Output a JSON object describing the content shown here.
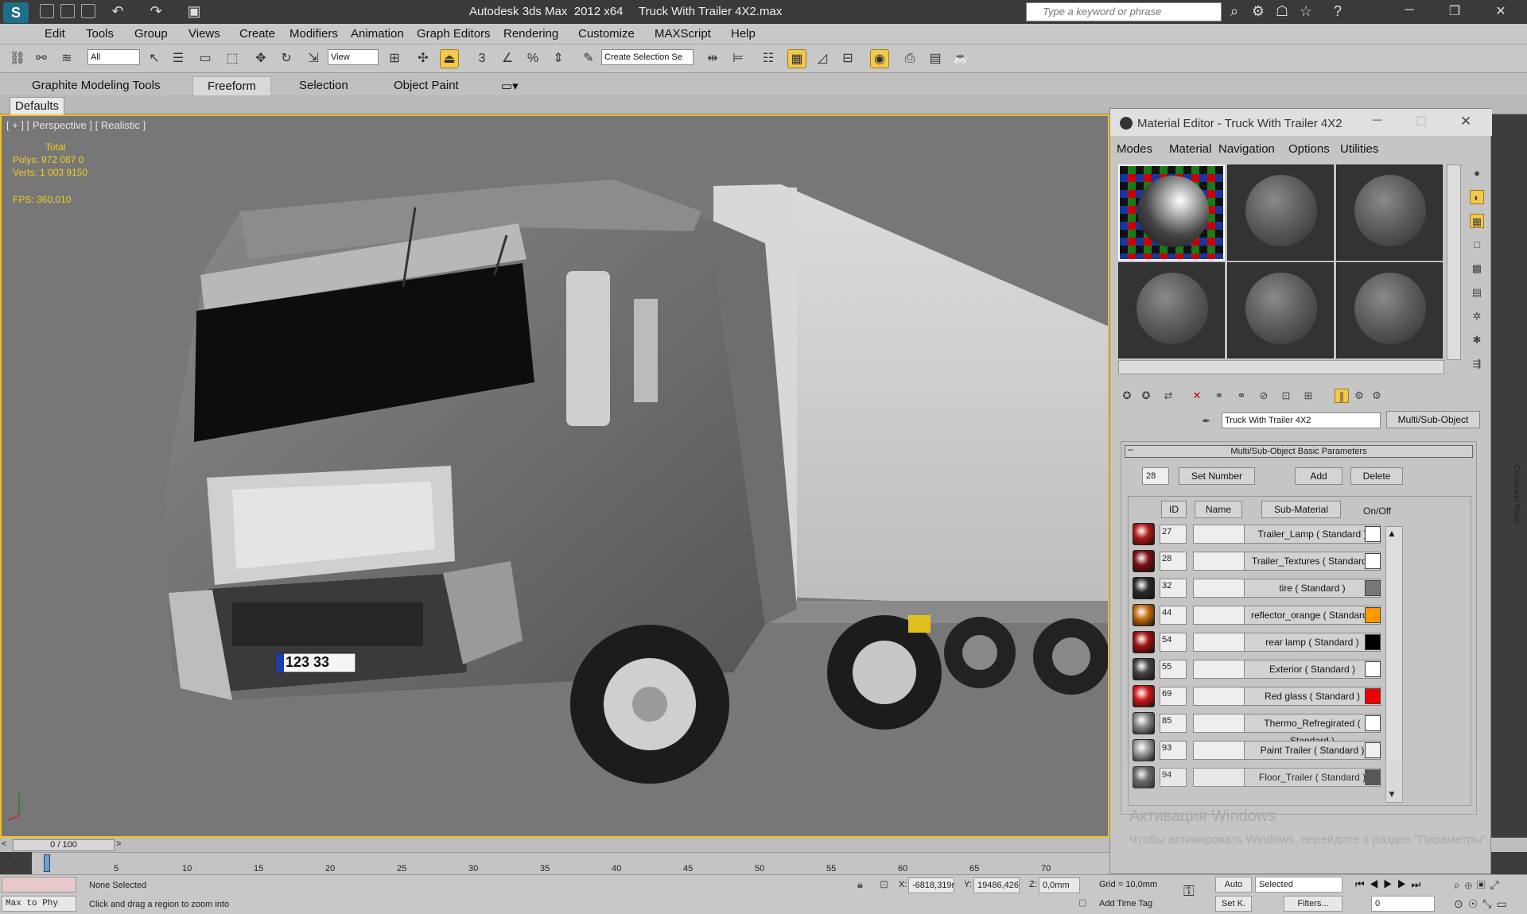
{
  "titlebar": {
    "logo": "S",
    "app_title": "Autodesk 3ds Max  2012 x64",
    "file_title": "Truck With Trailer 4X2.max",
    "search_placeholder": "Type a keyword or phrase"
  },
  "menu": [
    "Edit",
    "Tools",
    "Group",
    "Views",
    "Create",
    "Modifiers",
    "Animation",
    "Graph Editors",
    "Rendering",
    "Customize",
    "MAXScript",
    "Help"
  ],
  "toolbar": {
    "selection_filter": "All",
    "ref_coord": "View",
    "named_selection": "Create Selection Se"
  },
  "ribbon": {
    "tabs": [
      "Graphite Modeling Tools",
      "Freeform",
      "Selection",
      "Object Paint"
    ],
    "active": "Freeform",
    "defaults": "Defaults"
  },
  "viewport": {
    "label": "[ + ] [ Perspective ] [ Realistic ]",
    "stats_total": "Total",
    "polys": "Polys:  972 087   0",
    "verts": "Verts:  1 003 9150",
    "fps": "FPS:    360,010",
    "plate": "123 33"
  },
  "timeline": {
    "frame": "0 / 100",
    "ticks": [
      "0",
      "5",
      "10",
      "15",
      "20",
      "25",
      "30",
      "35",
      "40",
      "45",
      "50",
      "55",
      "60",
      "65",
      "70"
    ]
  },
  "status": {
    "maxscript": "Max to Phy",
    "selection": "None Selected",
    "prompt": "Click and drag a region to zoom into",
    "x_label": "X:",
    "x_value": "-6818,319r",
    "y_label": "Y:",
    "y_value": "19486,426",
    "z_label": "Z:",
    "z_value": "0,0mm",
    "grid": "Grid = 10,0mm",
    "add_time_tag": "Add Time Tag",
    "auto": "Auto",
    "set_key": "Set K.",
    "selected": "Selected",
    "filters": "Filters...",
    "frame_field": "0"
  },
  "material_editor": {
    "title": "Material Editor - Truck With Trailer 4X2",
    "menu": [
      "Modes",
      "Material",
      "Navigation",
      "Options",
      "Utilities"
    ],
    "material_name": "Truck With Trailer 4X2",
    "material_type": "Multi/Sub-Object",
    "rollout_title": "Multi/Sub-Object Basic Parameters",
    "collapse": "–",
    "count": "28",
    "set_number": "Set Number",
    "add": "Add",
    "delete": "Delete",
    "col_id": "ID",
    "col_name": "Name",
    "col_sub": "Sub-Material",
    "col_onoff": "On/Off",
    "rows": [
      {
        "id": "27",
        "sub": "Trailer_Lamp  ( Standard )",
        "color": "#ffffff",
        "thumb": "#b01818",
        "on": "✓"
      },
      {
        "id": "28",
        "sub": "Trailer_Textures  ( Standard )",
        "color": "#ffffff",
        "thumb": "#7a1010",
        "on": "✓"
      },
      {
        "id": "32",
        "sub": "tire  ( Standard )",
        "color": "#777777",
        "thumb": "#2a2a2a",
        "on": "✓"
      },
      {
        "id": "44",
        "sub": "reflector_orange  ( Standard )",
        "color": "#ff9900",
        "thumb": "#c46a10",
        "on": "✓"
      },
      {
        "id": "54",
        "sub": "rear lamp  ( Standard )",
        "color": "#000000",
        "thumb": "#a01010",
        "on": "✓"
      },
      {
        "id": "55",
        "sub": "Exterior  ( Standard )",
        "color": "#ffffff",
        "thumb": "#444444",
        "on": "✓"
      },
      {
        "id": "69",
        "sub": "Red glass  ( Standard )",
        "color": "#ee0000",
        "thumb": "#d01818",
        "on": "✓"
      },
      {
        "id": "85",
        "sub": "Thermo_Refregirated  ( Standard )",
        "color": "#ffffff",
        "thumb": "#888888",
        "on": "✓"
      },
      {
        "id": "93",
        "sub": "Paint Trailer  ( Standard )",
        "color": "#f0f0f0",
        "thumb": "#9a9a9a",
        "on": "✓"
      },
      {
        "id": "94",
        "sub": "Floor_Trailer  ( Standard )",
        "color": "#444444",
        "thumb": "#5a5a5a",
        "on": "✓"
      }
    ]
  },
  "watermark": {
    "line1": "Активация Windows",
    "line2": "Чтобы активировать Windows, перейдите в раздел \"Параметры\"."
  },
  "command_panel": "Command Panel"
}
